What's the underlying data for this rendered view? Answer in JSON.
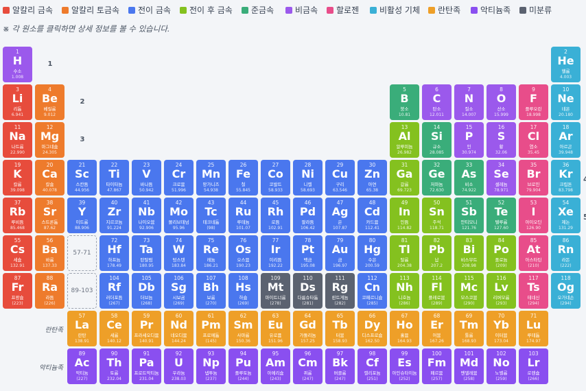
{
  "legend": [
    {
      "label": "알칼리 금속",
      "color": "#e74c3c"
    },
    {
      "label": "알칼리 토금속",
      "color": "#ee7b2c"
    },
    {
      "label": "전이 금속",
      "color": "#4a77ee"
    },
    {
      "label": "전이 후 금속",
      "color": "#84c11f"
    },
    {
      "label": "준금속",
      "color": "#3aad7a"
    },
    {
      "label": "비금속",
      "color": "#9b59ec"
    },
    {
      "label": "할로젠",
      "color": "#e84d8a"
    },
    {
      "label": "비활성 기체",
      "color": "#3ab0d6"
    },
    {
      "label": "란탄족",
      "color": "#ee9f28"
    },
    {
      "label": "악티늄족",
      "color": "#8a4ff0"
    },
    {
      "label": "미분류",
      "color": "#5b6270"
    }
  ],
  "hint": "※ 각 원소를 클릭하면 상세 정보를 볼 수 있습니다.",
  "periods": [
    "1",
    "2",
    "3"
  ],
  "placeholders": [
    "57-71",
    "89-103"
  ],
  "series_labels": {
    "lanthanide": "란탄족",
    "actinide": "악티늄족"
  },
  "edge_digits": [
    "4",
    "5"
  ],
  "elements": [
    {
      "n": "1",
      "s": "H",
      "k": "수소",
      "m": "1.008",
      "r": 1,
      "c": 1,
      "cat": "nonmetal"
    },
    {
      "n": "2",
      "s": "He",
      "k": "헬륨",
      "m": "4.003",
      "r": 1,
      "c": 18,
      "cat": "noble"
    },
    {
      "n": "3",
      "s": "Li",
      "k": "리튬",
      "m": "6.941",
      "r": 2,
      "c": 1,
      "cat": "alkali"
    },
    {
      "n": "4",
      "s": "Be",
      "k": "베릴륨",
      "m": "9.012",
      "r": 2,
      "c": 2,
      "cat": "alkaline"
    },
    {
      "n": "5",
      "s": "B",
      "k": "붕소",
      "m": "10.81",
      "r": 2,
      "c": 13,
      "cat": "metalloid"
    },
    {
      "n": "6",
      "s": "C",
      "k": "탄소",
      "m": "12.011",
      "r": 2,
      "c": 14,
      "cat": "nonmetal"
    },
    {
      "n": "7",
      "s": "N",
      "k": "질소",
      "m": "14.007",
      "r": 2,
      "c": 15,
      "cat": "nonmetal"
    },
    {
      "n": "8",
      "s": "O",
      "k": "산소",
      "m": "15.999",
      "r": 2,
      "c": 16,
      "cat": "nonmetal"
    },
    {
      "n": "9",
      "s": "F",
      "k": "플루오린",
      "m": "18.998",
      "r": 2,
      "c": 17,
      "cat": "halogen"
    },
    {
      "n": "10",
      "s": "Ne",
      "k": "네온",
      "m": "20.180",
      "r": 2,
      "c": 18,
      "cat": "noble"
    },
    {
      "n": "11",
      "s": "Na",
      "k": "나트륨",
      "m": "22.990",
      "r": 3,
      "c": 1,
      "cat": "alkali"
    },
    {
      "n": "12",
      "s": "Mg",
      "k": "마그네슘",
      "m": "24.305",
      "r": 3,
      "c": 2,
      "cat": "alkaline"
    },
    {
      "n": "13",
      "s": "Al",
      "k": "알루미늄",
      "m": "26.982",
      "r": 3,
      "c": 13,
      "cat": "post"
    },
    {
      "n": "14",
      "s": "Si",
      "k": "규소",
      "m": "28.085",
      "r": 3,
      "c": 14,
      "cat": "metalloid"
    },
    {
      "n": "15",
      "s": "P",
      "k": "인",
      "m": "30.974",
      "r": 3,
      "c": 15,
      "cat": "nonmetal"
    },
    {
      "n": "16",
      "s": "S",
      "k": "황",
      "m": "32.06",
      "r": 3,
      "c": 16,
      "cat": "nonmetal"
    },
    {
      "n": "17",
      "s": "Cl",
      "k": "염소",
      "m": "35.45",
      "r": 3,
      "c": 17,
      "cat": "halogen"
    },
    {
      "n": "18",
      "s": "Ar",
      "k": "아르곤",
      "m": "39.948",
      "r": 3,
      "c": 18,
      "cat": "noble"
    },
    {
      "n": "19",
      "s": "K",
      "k": "칼륨",
      "m": "39.098",
      "r": 4,
      "c": 1,
      "cat": "alkali"
    },
    {
      "n": "20",
      "s": "Ca",
      "k": "칼슘",
      "m": "40.078",
      "r": 4,
      "c": 2,
      "cat": "alkaline"
    },
    {
      "n": "21",
      "s": "Sc",
      "k": "스칸듐",
      "m": "44.956",
      "r": 4,
      "c": 3,
      "cat": "transition"
    },
    {
      "n": "22",
      "s": "Ti",
      "k": "타이타늄",
      "m": "47.867",
      "r": 4,
      "c": 4,
      "cat": "transition"
    },
    {
      "n": "23",
      "s": "V",
      "k": "바나듐",
      "m": "50.942",
      "r": 4,
      "c": 5,
      "cat": "transition"
    },
    {
      "n": "24",
      "s": "Cr",
      "k": "크로뮴",
      "m": "51.996",
      "r": 4,
      "c": 6,
      "cat": "transition"
    },
    {
      "n": "25",
      "s": "Mn",
      "k": "망가니즈",
      "m": "54.938",
      "r": 4,
      "c": 7,
      "cat": "transition"
    },
    {
      "n": "26",
      "s": "Fe",
      "k": "철",
      "m": "55.845",
      "r": 4,
      "c": 8,
      "cat": "transition"
    },
    {
      "n": "27",
      "s": "Co",
      "k": "코발트",
      "m": "58.933",
      "r": 4,
      "c": 9,
      "cat": "transition"
    },
    {
      "n": "28",
      "s": "Ni",
      "k": "니켈",
      "m": "58.693",
      "r": 4,
      "c": 10,
      "cat": "transition"
    },
    {
      "n": "29",
      "s": "Cu",
      "k": "구리",
      "m": "63.546",
      "r": 4,
      "c": 11,
      "cat": "transition"
    },
    {
      "n": "30",
      "s": "Zn",
      "k": "아연",
      "m": "65.38",
      "r": 4,
      "c": 12,
      "cat": "transition"
    },
    {
      "n": "31",
      "s": "Ga",
      "k": "갈륨",
      "m": "69.723",
      "r": 4,
      "c": 13,
      "cat": "post"
    },
    {
      "n": "32",
      "s": "Ge",
      "k": "저마늄",
      "m": "72.630",
      "r": 4,
      "c": 14,
      "cat": "metalloid"
    },
    {
      "n": "33",
      "s": "As",
      "k": "비소",
      "m": "74.922",
      "r": 4,
      "c": 15,
      "cat": "metalloid"
    },
    {
      "n": "34",
      "s": "Se",
      "k": "셀레늄",
      "m": "78.971",
      "r": 4,
      "c": 16,
      "cat": "nonmetal"
    },
    {
      "n": "35",
      "s": "Br",
      "k": "브로민",
      "m": "79.904",
      "r": 4,
      "c": 17,
      "cat": "halogen"
    },
    {
      "n": "36",
      "s": "Kr",
      "k": "크립톤",
      "m": "83.798",
      "r": 4,
      "c": 18,
      "cat": "noble"
    },
    {
      "n": "37",
      "s": "Rb",
      "k": "루비듐",
      "m": "85.468",
      "r": 5,
      "c": 1,
      "cat": "alkali"
    },
    {
      "n": "38",
      "s": "Sr",
      "k": "스트론튬",
      "m": "87.62",
      "r": 5,
      "c": 2,
      "cat": "alkaline"
    },
    {
      "n": "39",
      "s": "Y",
      "k": "이트륨",
      "m": "88.906",
      "r": 5,
      "c": 3,
      "cat": "transition"
    },
    {
      "n": "40",
      "s": "Zr",
      "k": "지르코늄",
      "m": "91.224",
      "r": 5,
      "c": 4,
      "cat": "transition"
    },
    {
      "n": "41",
      "s": "Nb",
      "k": "나이오븀",
      "m": "92.906",
      "r": 5,
      "c": 5,
      "cat": "transition"
    },
    {
      "n": "42",
      "s": "Mo",
      "k": "몰리브데넘",
      "m": "95.96",
      "r": 5,
      "c": 6,
      "cat": "transition"
    },
    {
      "n": "43",
      "s": "Tc",
      "k": "테크네튬",
      "m": "(98)",
      "r": 5,
      "c": 7,
      "cat": "transition"
    },
    {
      "n": "44",
      "s": "Ru",
      "k": "루테늄",
      "m": "101.07",
      "r": 5,
      "c": 8,
      "cat": "transition"
    },
    {
      "n": "45",
      "s": "Rh",
      "k": "로듐",
      "m": "102.91",
      "r": 5,
      "c": 9,
      "cat": "transition"
    },
    {
      "n": "46",
      "s": "Pd",
      "k": "팔라듐",
      "m": "106.42",
      "r": 5,
      "c": 10,
      "cat": "transition"
    },
    {
      "n": "47",
      "s": "Ag",
      "k": "은",
      "m": "107.87",
      "r": 5,
      "c": 11,
      "cat": "transition"
    },
    {
      "n": "48",
      "s": "Cd",
      "k": "카드뮴",
      "m": "112.41",
      "r": 5,
      "c": 12,
      "cat": "transition"
    },
    {
      "n": "49",
      "s": "In",
      "k": "인듐",
      "m": "114.82",
      "r": 5,
      "c": 13,
      "cat": "post"
    },
    {
      "n": "50",
      "s": "Sn",
      "k": "주석",
      "m": "118.71",
      "r": 5,
      "c": 14,
      "cat": "post"
    },
    {
      "n": "51",
      "s": "Sb",
      "k": "안티모니",
      "m": "121.76",
      "r": 5,
      "c": 15,
      "cat": "metalloid"
    },
    {
      "n": "52",
      "s": "Te",
      "k": "텔루륨",
      "m": "127.60",
      "r": 5,
      "c": 16,
      "cat": "metalloid"
    },
    {
      "n": "53",
      "s": "I",
      "k": "아이오딘",
      "m": "126.90",
      "r": 5,
      "c": 17,
      "cat": "halogen"
    },
    {
      "n": "54",
      "s": "Xe",
      "k": "제논",
      "m": "131.29",
      "r": 5,
      "c": 18,
      "cat": "noble"
    },
    {
      "n": "55",
      "s": "Cs",
      "k": "세슘",
      "m": "132.91",
      "r": 6,
      "c": 1,
      "cat": "alkali"
    },
    {
      "n": "56",
      "s": "Ba",
      "k": "바륨",
      "m": "137.33",
      "r": 6,
      "c": 2,
      "cat": "alkaline"
    },
    {
      "n": "72",
      "s": "Hf",
      "k": "하프늄",
      "m": "178.49",
      "r": 6,
      "c": 4,
      "cat": "transition"
    },
    {
      "n": "73",
      "s": "Ta",
      "k": "탄탈럼",
      "m": "180.95",
      "r": 6,
      "c": 5,
      "cat": "transition"
    },
    {
      "n": "74",
      "s": "W",
      "k": "텅스텐",
      "m": "183.84",
      "r": 6,
      "c": 6,
      "cat": "transition"
    },
    {
      "n": "75",
      "s": "Re",
      "k": "레늄",
      "m": "186.21",
      "r": 6,
      "c": 7,
      "cat": "transition"
    },
    {
      "n": "76",
      "s": "Os",
      "k": "오스뮴",
      "m": "190.23",
      "r": 6,
      "c": 8,
      "cat": "transition"
    },
    {
      "n": "77",
      "s": "Ir",
      "k": "이리듐",
      "m": "192.22",
      "r": 6,
      "c": 9,
      "cat": "transition"
    },
    {
      "n": "78",
      "s": "Pt",
      "k": "백금",
      "m": "195.08",
      "r": 6,
      "c": 10,
      "cat": "transition"
    },
    {
      "n": "79",
      "s": "Au",
      "k": "금",
      "m": "196.97",
      "r": 6,
      "c": 11,
      "cat": "transition"
    },
    {
      "n": "80",
      "s": "Hg",
      "k": "수은",
      "m": "200.59",
      "r": 6,
      "c": 12,
      "cat": "transition"
    },
    {
      "n": "81",
      "s": "Tl",
      "k": "탈륨",
      "m": "204.38",
      "r": 6,
      "c": 13,
      "cat": "post"
    },
    {
      "n": "82",
      "s": "Pb",
      "k": "납",
      "m": "207.2",
      "r": 6,
      "c": 14,
      "cat": "post"
    },
    {
      "n": "83",
      "s": "Bi",
      "k": "비스무트",
      "m": "208.98",
      "r": 6,
      "c": 15,
      "cat": "post"
    },
    {
      "n": "84",
      "s": "Po",
      "k": "폴로늄",
      "m": "(209)",
      "r": 6,
      "c": 16,
      "cat": "post"
    },
    {
      "n": "85",
      "s": "At",
      "k": "아스타틴",
      "m": "(210)",
      "r": 6,
      "c": 17,
      "cat": "halogen"
    },
    {
      "n": "86",
      "s": "Rn",
      "k": "라돈",
      "m": "(222)",
      "r": 6,
      "c": 18,
      "cat": "noble"
    },
    {
      "n": "87",
      "s": "Fr",
      "k": "프랑슘",
      "m": "(223)",
      "r": 7,
      "c": 1,
      "cat": "alkali"
    },
    {
      "n": "88",
      "s": "Ra",
      "k": "라듐",
      "m": "(226)",
      "r": 7,
      "c": 2,
      "cat": "alkaline"
    },
    {
      "n": "104",
      "s": "Rf",
      "k": "러더포듐",
      "m": "(267)",
      "r": 7,
      "c": 4,
      "cat": "transition"
    },
    {
      "n": "105",
      "s": "Db",
      "k": "더브늄",
      "m": "(268)",
      "r": 7,
      "c": 5,
      "cat": "transition"
    },
    {
      "n": "106",
      "s": "Sg",
      "k": "시보귬",
      "m": "(269)",
      "r": 7,
      "c": 6,
      "cat": "transition"
    },
    {
      "n": "107",
      "s": "Bh",
      "k": "보륨",
      "m": "(270)",
      "r": 7,
      "c": 7,
      "cat": "transition"
    },
    {
      "n": "108",
      "s": "Hs",
      "k": "하슘",
      "m": "(269)",
      "r": 7,
      "c": 8,
      "cat": "transition"
    },
    {
      "n": "109",
      "s": "Mt",
      "k": "마이트너륨",
      "m": "(278)",
      "r": 7,
      "c": 9,
      "cat": "unknown"
    },
    {
      "n": "110",
      "s": "Ds",
      "k": "다름슈타튬",
      "m": "(281)",
      "r": 7,
      "c": 10,
      "cat": "unknown"
    },
    {
      "n": "111",
      "s": "Rg",
      "k": "뢴트게늄",
      "m": "(282)",
      "r": 7,
      "c": 11,
      "cat": "unknown"
    },
    {
      "n": "112",
      "s": "Cn",
      "k": "코페르니슘",
      "m": "(285)",
      "r": 7,
      "c": 12,
      "cat": "transition"
    },
    {
      "n": "113",
      "s": "Nh",
      "k": "니호늄",
      "m": "(286)",
      "r": 7,
      "c": 13,
      "cat": "post"
    },
    {
      "n": "114",
      "s": "Fl",
      "k": "플레로븀",
      "m": "(289)",
      "r": 7,
      "c": 14,
      "cat": "post"
    },
    {
      "n": "115",
      "s": "Mc",
      "k": "모스코븀",
      "m": "(290)",
      "r": 7,
      "c": 15,
      "cat": "post"
    },
    {
      "n": "116",
      "s": "Lv",
      "k": "리버모륨",
      "m": "(293)",
      "r": 7,
      "c": 16,
      "cat": "post"
    },
    {
      "n": "117",
      "s": "Ts",
      "k": "테네신",
      "m": "(294)",
      "r": 7,
      "c": 17,
      "cat": "halogen"
    },
    {
      "n": "118",
      "s": "Og",
      "k": "오가네손",
      "m": "(294)",
      "r": 7,
      "c": 18,
      "cat": "noble"
    },
    {
      "n": "57",
      "s": "La",
      "k": "란탄",
      "m": "138.91",
      "r": 8,
      "c": 3,
      "cat": "lanthanide"
    },
    {
      "n": "58",
      "s": "Ce",
      "k": "세륨",
      "m": "140.12",
      "r": 8,
      "c": 4,
      "cat": "lanthanide"
    },
    {
      "n": "59",
      "s": "Pr",
      "k": "프라세오디뮴",
      "m": "140.91",
      "r": 8,
      "c": 5,
      "cat": "lanthanide"
    },
    {
      "n": "60",
      "s": "Nd",
      "k": "네오디뮴",
      "m": "144.24",
      "r": 8,
      "c": 6,
      "cat": "lanthanide"
    },
    {
      "n": "61",
      "s": "Pm",
      "k": "프로메튬",
      "m": "(145)",
      "r": 8,
      "c": 7,
      "cat": "lanthanide"
    },
    {
      "n": "62",
      "s": "Sm",
      "k": "사마륨",
      "m": "150.36",
      "r": 8,
      "c": 8,
      "cat": "lanthanide"
    },
    {
      "n": "63",
      "s": "Eu",
      "k": "유로퓸",
      "m": "151.96",
      "r": 8,
      "c": 9,
      "cat": "lanthanide"
    },
    {
      "n": "64",
      "s": "Gd",
      "k": "가돌리늄",
      "m": "157.25",
      "r": 8,
      "c": 10,
      "cat": "lanthanide"
    },
    {
      "n": "65",
      "s": "Tb",
      "k": "터븀",
      "m": "158.93",
      "r": 8,
      "c": 11,
      "cat": "lanthanide"
    },
    {
      "n": "66",
      "s": "Dy",
      "k": "디스프로슘",
      "m": "162.50",
      "r": 8,
      "c": 12,
      "cat": "lanthanide"
    },
    {
      "n": "67",
      "s": "Ho",
      "k": "홀뮴",
      "m": "164.93",
      "r": 8,
      "c": 13,
      "cat": "lanthanide"
    },
    {
      "n": "68",
      "s": "Er",
      "k": "어븀",
      "m": "167.26",
      "r": 8,
      "c": 14,
      "cat": "lanthanide"
    },
    {
      "n": "69",
      "s": "Tm",
      "k": "툴륨",
      "m": "168.93",
      "r": 8,
      "c": 15,
      "cat": "lanthanide"
    },
    {
      "n": "70",
      "s": "Yb",
      "k": "이터븀",
      "m": "173.04",
      "r": 8,
      "c": 16,
      "cat": "lanthanide"
    },
    {
      "n": "71",
      "s": "Lu",
      "k": "루테튬",
      "m": "174.97",
      "r": 8,
      "c": 17,
      "cat": "lanthanide"
    },
    {
      "n": "89",
      "s": "Ac",
      "k": "악티늄",
      "m": "(227)",
      "r": 9,
      "c": 3,
      "cat": "actinide"
    },
    {
      "n": "90",
      "s": "Th",
      "k": "토륨",
      "m": "232.04",
      "r": 9,
      "c": 4,
      "cat": "actinide"
    },
    {
      "n": "91",
      "s": "Pa",
      "k": "프로트악티늄",
      "m": "231.04",
      "r": 9,
      "c": 5,
      "cat": "actinide"
    },
    {
      "n": "92",
      "s": "U",
      "k": "우라늄",
      "m": "238.03",
      "r": 9,
      "c": 6,
      "cat": "actinide"
    },
    {
      "n": "93",
      "s": "Np",
      "k": "넵투늄",
      "m": "(237)",
      "r": 9,
      "c": 7,
      "cat": "actinide"
    },
    {
      "n": "94",
      "s": "Pu",
      "k": "플루토늄",
      "m": "(244)",
      "r": 9,
      "c": 8,
      "cat": "actinide"
    },
    {
      "n": "95",
      "s": "Am",
      "k": "아메리슘",
      "m": "(243)",
      "r": 9,
      "c": 9,
      "cat": "actinide"
    },
    {
      "n": "96",
      "s": "Cm",
      "k": "퀴륨",
      "m": "(247)",
      "r": 9,
      "c": 10,
      "cat": "actinide"
    },
    {
      "n": "97",
      "s": "Bk",
      "k": "버클륨",
      "m": "(247)",
      "r": 9,
      "c": 11,
      "cat": "actinide"
    },
    {
      "n": "98",
      "s": "Cf",
      "k": "캘리포늄",
      "m": "(251)",
      "r": 9,
      "c": 12,
      "cat": "actinide"
    },
    {
      "n": "99",
      "s": "Es",
      "k": "아인슈타이늄",
      "m": "(252)",
      "r": 9,
      "c": 13,
      "cat": "actinide"
    },
    {
      "n": "100",
      "s": "Fm",
      "k": "페르뮴",
      "m": "(257)",
      "r": 9,
      "c": 14,
      "cat": "actinide"
    },
    {
      "n": "101",
      "s": "Md",
      "k": "멘델레븀",
      "m": "(258)",
      "r": 9,
      "c": 15,
      "cat": "actinide"
    },
    {
      "n": "102",
      "s": "No",
      "k": "노벨륨",
      "m": "(259)",
      "r": 9,
      "c": 16,
      "cat": "actinide"
    },
    {
      "n": "103",
      "s": "Lr",
      "k": "로렌슘",
      "m": "(266)",
      "r": 9,
      "c": 17,
      "cat": "actinide"
    }
  ],
  "category_colors": {
    "alkali": "#e74c3c",
    "alkaline": "#ee7b2c",
    "transition": "#4a77ee",
    "post": "#84c11f",
    "metalloid": "#3aad7a",
    "nonmetal": "#9b59ec",
    "halogen": "#e84d8a",
    "noble": "#3ab0d6",
    "lanthanide": "#ee9f28",
    "actinide": "#8a4ff0",
    "unknown": "#5b6270"
  }
}
